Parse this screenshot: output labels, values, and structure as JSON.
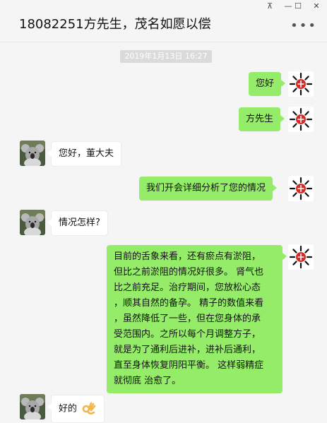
{
  "window": {
    "title": "18082251方先生，茂名如愿以偿",
    "pin_icon": "pin-icon",
    "minimize_icon": "minimize-icon",
    "maximize_icon": "maximize-icon",
    "close_icon": "close-icon",
    "more_icon": "more-icon",
    "pin_glyph": "⊼",
    "minimize_glyph": "—",
    "maximize_glyph": "☐",
    "close_glyph": "✕",
    "more_glyph": "•••"
  },
  "timestamp": "2019年1月13日 16:27",
  "colors": {
    "my_bubble": "#95ec69",
    "their_bubble": "#ffffff",
    "background": "#f5f5f5"
  },
  "messages": [
    {
      "sender": "me",
      "text": "您好"
    },
    {
      "sender": "me",
      "text": "方先生"
    },
    {
      "sender": "them",
      "text": "您好，董大夫"
    },
    {
      "sender": "me",
      "text": "我们开会详细分析了您的情况"
    },
    {
      "sender": "them",
      "text": "情况怎样?"
    },
    {
      "sender": "me",
      "lines": [
        "目前的舌象来看，还有瘀点有淤阻，",
        "但比之前淤阻的情况好很多。 肾气也",
        "比之前充足。治疗期间，您放松心态",
        "，顺其自然的备孕。 精子的数值来看",
        "，虽然降低了一些，但在您身体的承",
        "受范围内。之所以每个月调整方子，",
        "就是为了通利后进补，进补后通利，",
        "直至身体恢复阴阳平衡。 这样弱精症",
        "就彻底 治愈了。"
      ]
    },
    {
      "sender": "them",
      "text": "好的",
      "emoji": "ok-hand-emoji"
    }
  ]
}
